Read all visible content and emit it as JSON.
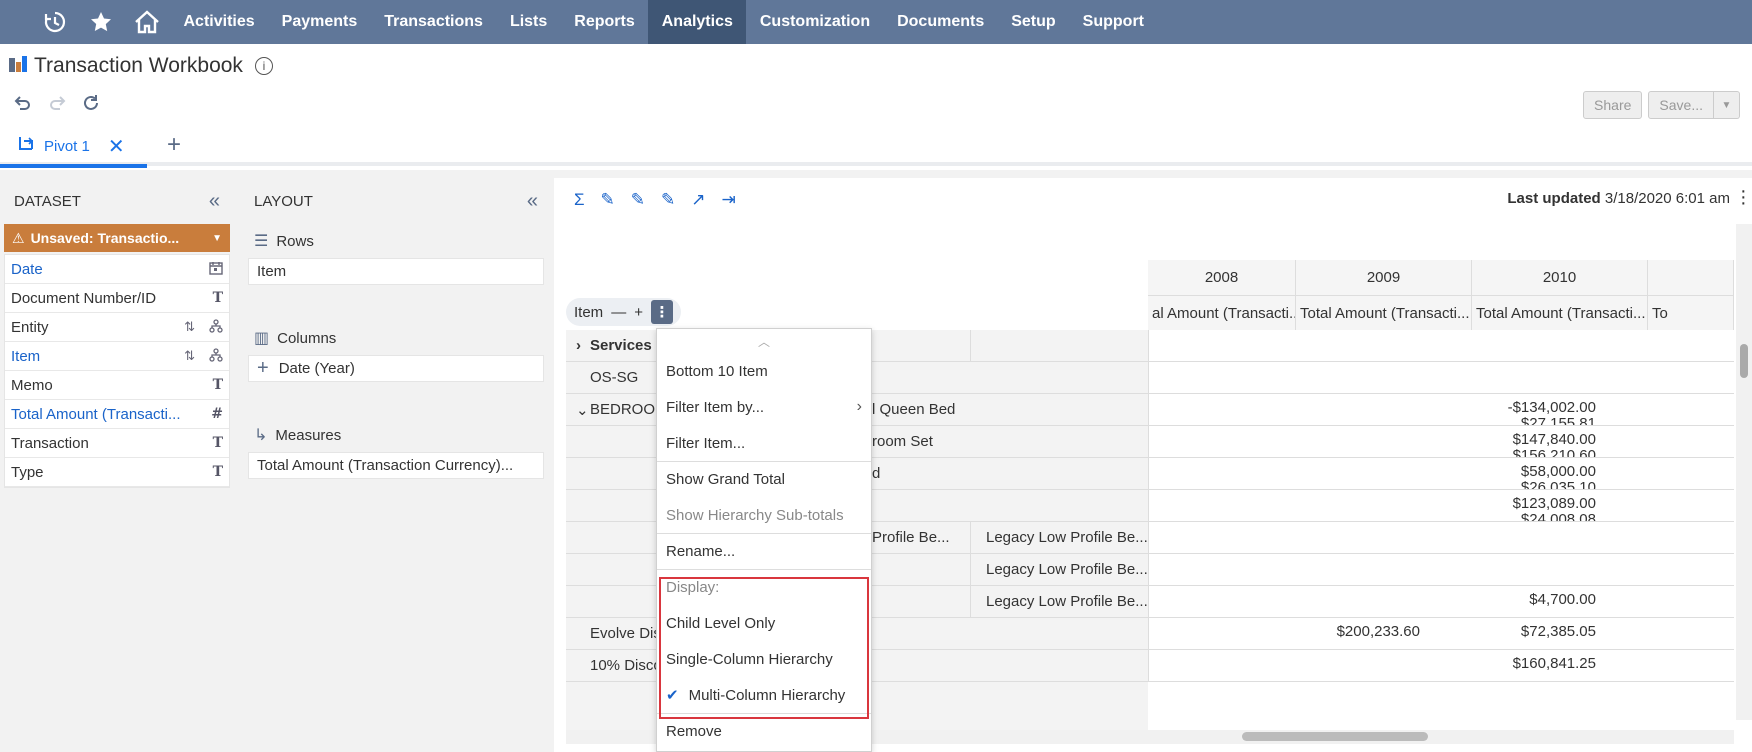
{
  "nav": {
    "icons": [
      "recent-icon",
      "star-icon",
      "home-icon"
    ],
    "items": [
      "Activities",
      "Payments",
      "Transactions",
      "Lists",
      "Reports",
      "Analytics",
      "Customization",
      "Documents",
      "Setup",
      "Support"
    ],
    "active": "Analytics"
  },
  "page": {
    "title": "Transaction Workbook",
    "info": "i"
  },
  "actions": {
    "share": "Share",
    "save": "Save..."
  },
  "tabs": [
    {
      "label": "Pivot 1"
    }
  ],
  "dataset": {
    "header": "DATASET",
    "unsaved": "Unsaved: Transactio...",
    "fields": [
      {
        "name": "Date",
        "selected": true,
        "type": "date"
      },
      {
        "name": "Document Number/ID",
        "selected": false,
        "type": "text"
      },
      {
        "name": "Entity",
        "selected": false,
        "type": "hierarchy"
      },
      {
        "name": "Item",
        "selected": true,
        "type": "hierarchy"
      },
      {
        "name": "Memo",
        "selected": false,
        "type": "text"
      },
      {
        "name": "Total Amount (Transacti...",
        "selected": true,
        "type": "number"
      },
      {
        "name": "Transaction",
        "selected": false,
        "type": "text"
      },
      {
        "name": "Type",
        "selected": false,
        "type": "text"
      }
    ]
  },
  "layout": {
    "header": "LAYOUT",
    "rows_label": "Rows",
    "rows_value": "Item",
    "columns_label": "Columns",
    "columns_value": "Date  (Year)",
    "measures_label": "Measures",
    "measures_value": "Total Amount (Transaction Currency)..."
  },
  "pivot": {
    "last_updated_label": "Last updated",
    "last_updated_value": "3/18/2020 6:01 am",
    "item_chip": "Item",
    "years": [
      "2008",
      "2009",
      "2010"
    ],
    "measure_header": "Total Amount (Transacti...",
    "measure_header_cut": "al Amount (Transacti...",
    "measure_header_last": "To",
    "rows": [
      {
        "label": "Services",
        "bold": true,
        "sub": "",
        "sub2": "",
        "v2009": "",
        "v2010": ""
      },
      {
        "label": "OS-SG",
        "bold": false,
        "sub": "",
        "sub2": "",
        "v2009": "",
        "v2010": ""
      },
      {
        "label": "BEDROOM",
        "bold": false,
        "sub": "l Queen Bed",
        "sub2": "",
        "v2009": "",
        "v2010": "-$134,002.00"
      },
      {
        "label": "",
        "bold": false,
        "sub": "room Set",
        "sub2": "",
        "v2009": "",
        "v2010": "$147,840.00"
      },
      {
        "label": "",
        "bold": false,
        "sub": "d",
        "sub2": "",
        "v2009": "",
        "v2010": "$58,000.00"
      },
      {
        "label": "",
        "bold": false,
        "sub": "",
        "sub2": "",
        "v2009": "",
        "v2010": "$123,089.00"
      },
      {
        "label": "",
        "bold": false,
        "sub": "Profile Be...",
        "sub2": "Legacy Low Profile Be...",
        "v2009": "",
        "v2010": ""
      },
      {
        "label": "",
        "bold": false,
        "sub": "",
        "sub2": "Legacy Low Profile Be...",
        "v2009": "",
        "v2010": ""
      },
      {
        "label": "",
        "bold": false,
        "sub": "",
        "sub2": "Legacy Low Profile Be...",
        "v2009": "",
        "v2010": "$4,700.00"
      },
      {
        "label": "Evolve Dis",
        "bold": false,
        "sub": "",
        "sub2": "",
        "v2009": "$200,233.60",
        "v2010": "$72,385.05"
      },
      {
        "label": "10% Disco",
        "bold": false,
        "sub": "",
        "sub2": "",
        "v2009": "",
        "v2010": "$160,841.25"
      }
    ],
    "partial_values": [
      "$27,155.81",
      "$156,210.60",
      "$26,035.10",
      "$24,008.08"
    ]
  },
  "menu": {
    "items": [
      {
        "label": "Bottom 10 Item",
        "disabled": false,
        "sep": false,
        "sub": false
      },
      {
        "label": "Filter Item by...",
        "disabled": false,
        "sep": false,
        "sub": true
      },
      {
        "label": "Filter Item...",
        "disabled": false,
        "sep": false,
        "sub": false
      },
      {
        "label": "Show Grand Total",
        "disabled": false,
        "sep": true,
        "sub": false
      },
      {
        "label": "Show Hierarchy Sub-totals",
        "disabled": true,
        "sep": false,
        "sub": false
      },
      {
        "label": "Rename...",
        "disabled": false,
        "sep": true,
        "sub": false
      },
      {
        "label": "Display:",
        "disabled": true,
        "sep": true,
        "sub": false
      },
      {
        "label": "Child Level Only",
        "disabled": false,
        "sep": false,
        "sub": false
      },
      {
        "label": "Single-Column Hierarchy",
        "disabled": false,
        "sep": false,
        "sub": false
      },
      {
        "label": "Multi-Column Hierarchy",
        "disabled": false,
        "sep": false,
        "sub": false,
        "checked": true
      },
      {
        "label": "Remove",
        "disabled": false,
        "sep": true,
        "sub": false
      }
    ]
  },
  "colors": {
    "nav_bg": "#607799",
    "nav_active": "#3f5675",
    "accent": "#1a73e8",
    "unsaved": "#c97d3c",
    "highlight": "#d9363e"
  }
}
